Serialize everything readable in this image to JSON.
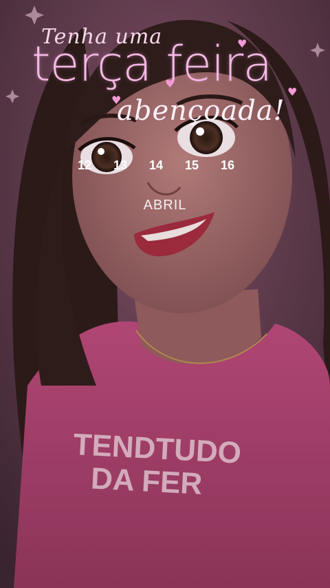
{
  "greeting": {
    "line1": "Tenha uma",
    "line2": "terça feira",
    "line3": "abençoada!"
  },
  "calendar": {
    "dates": [
      "12",
      "13",
      "14",
      "15",
      "16"
    ],
    "month": "ABRIL"
  },
  "shirt": {
    "line1": "TENDTUDO",
    "line2": "DA FER"
  },
  "colors": {
    "shirt_pink": "#b04673",
    "title_pink": "#f3b8e4",
    "background_dark": "#2a1a22"
  }
}
